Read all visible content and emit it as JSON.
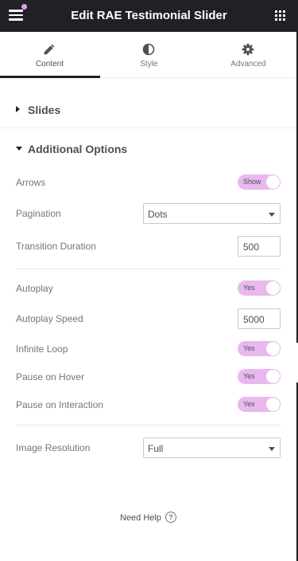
{
  "header": {
    "title": "Edit RAE Testimonial Slider"
  },
  "tabs": [
    {
      "label": "Content",
      "icon": "pencil-icon"
    },
    {
      "label": "Style",
      "icon": "contrast-icon"
    },
    {
      "label": "Advanced",
      "icon": "gear-icon"
    }
  ],
  "sections": {
    "slides": {
      "label": "Slides",
      "expanded": false
    },
    "additional": {
      "label": "Additional Options",
      "expanded": true
    }
  },
  "options": {
    "arrows": {
      "label": "Arrows",
      "toggle": "Show"
    },
    "pagination": {
      "label": "Pagination",
      "value": "Dots"
    },
    "transition_duration": {
      "label": "Transition Duration",
      "value": "500"
    },
    "autoplay": {
      "label": "Autoplay",
      "toggle": "Yes"
    },
    "autoplay_speed": {
      "label": "Autoplay Speed",
      "value": "5000"
    },
    "infinite_loop": {
      "label": "Infinite Loop",
      "toggle": "Yes"
    },
    "pause_on_hover": {
      "label": "Pause on Hover",
      "toggle": "Yes"
    },
    "pause_on_interaction": {
      "label": "Pause on Interaction",
      "toggle": "Yes"
    },
    "image_resolution": {
      "label": "Image Resolution",
      "value": "Full"
    }
  },
  "help": {
    "label": "Need Help",
    "icon": "question-circle-icon"
  },
  "colors": {
    "header_bg": "#1f2124",
    "toggle_on": "#e8b8ee",
    "accent_dot": "#e29ee8"
  }
}
